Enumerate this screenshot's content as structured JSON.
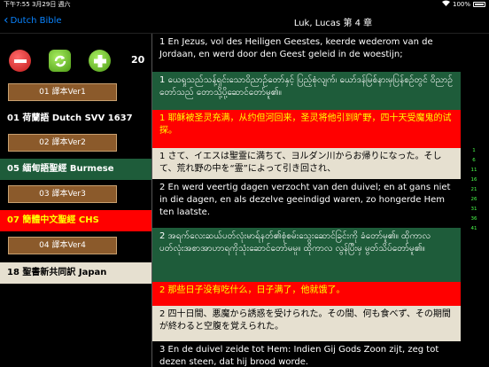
{
  "status": {
    "time": "下午7:55",
    "date": "3月29日 週六",
    "battery": "100%"
  },
  "nav": {
    "back_label": "Dutch Bible",
    "title": "Luk, Lucas 第 4 章"
  },
  "sidebar": {
    "count": "20",
    "versions": [
      {
        "button": "01 譯本Ver1",
        "label": "01 荷蘭語 Dutch SVV 1637",
        "label_bg": "#000000",
        "label_color": "#ffffff"
      },
      {
        "button": "02 譯本Ver2",
        "label": "05 緬甸語聖經 Burmese",
        "label_bg": "#1e5c3a",
        "label_color": "#ffffff"
      },
      {
        "button": "03 譯本Ver3",
        "label": "07 簡體中文聖經 CHS",
        "label_bg": "#ff0000",
        "label_color": "#ffff00"
      },
      {
        "button": "04 譯本Ver4",
        "label": "18 聖書新共同訳 Japan",
        "label_bg": "#e6e0d0",
        "label_color": "#000000"
      }
    ]
  },
  "verses": [
    {
      "text": "1 En Jezus, vol des Heiligen Geestes, keerde wederom van de Jordaan, en werd door den Geest geleid in de woestijn;",
      "bg": "#000000",
      "color": "#ffffff"
    },
    {
      "text": "1 ယေရှုသည်သန့်ရှင်းသောဝိညာဉ်တော်နှင့် ပြည့်စုံလျက်၊ ယော်ဒန်မြစ်နားမှပြန်စဉ်တွင် ဝိညာဉ်တော်သည် တောသို့ပို့ဆောင်တော်မူ၏။",
      "bg": "#1e5c3a",
      "color": "#ffffff"
    },
    {
      "text": "1 耶稣被圣灵充满，从约但河回来，圣灵将他引到旷野，四十天受魔鬼的试探。",
      "bg": "#ff0000",
      "color": "#ffff00"
    },
    {
      "text": "1 さて、イエスは聖霊に満ちて、ヨルダン川からお帰りになった。そして、荒れ野の中を“霊”によって引き回され、",
      "bg": "#e6e0d0",
      "color": "#000000"
    },
    {
      "text": "2 En werd veertig dagen verzocht van den duivel; en at gans niet in die dagen, en als dezelve geeindigd waren, zo hongerde Hem ten laatste.",
      "bg": "#000000",
      "color": "#ffffff"
    },
    {
      "text": "2 အရက်လေးဆယ်ပတ်လုံးမာရ်နတ်၏စုံစမ်းသွေးဆောင်ခြင်းကို ခံတော်မူ၏။ ထိုကာလပတ်လုံးအစာအာဟာရကိုသုံးဆောင်တော်မမူ။ ထိုကာလ လွန်ပြီးမှ မွတ်သိပ်တော်မူ၏။",
      "bg": "#1e5c3a",
      "color": "#ffffff"
    },
    {
      "text": "2 那些日子没有吃什么，日子满了，他就饿了。",
      "bg": "#ff0000",
      "color": "#ffff00"
    },
    {
      "text": "2 四十日間、悪魔から誘惑を受けられた。その間、何も食べず、その期間が終わると空腹を覚えられた。",
      "bg": "#e6e0d0",
      "color": "#000000"
    },
    {
      "text": "3 En de duivel zeide tot Hem: Indien Gij Gods Zoon zijt, zeg tot dezen steen, dat hij brood worde.",
      "bg": "#000000",
      "color": "#ffffff"
    }
  ],
  "scroll_index": [
    "1",
    "6",
    "11",
    "16",
    "21",
    "26",
    "31",
    "36",
    "41"
  ]
}
